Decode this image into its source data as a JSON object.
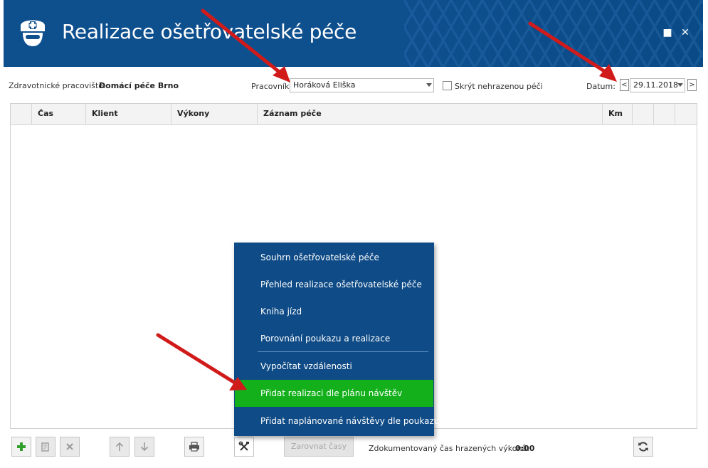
{
  "window": {
    "title": "Realizace ošetřovatelské péče",
    "controls": {
      "maximize_icon": "■",
      "close_icon": "✕"
    }
  },
  "toolbar": {
    "workplace_label": "Zdravotnické pracoviště:",
    "workplace_value": "Domácí péče Brno",
    "worker_label": "Pracovník:",
    "worker_value": "Horáková Eliška",
    "hide_unpaid_label": "Skrýt nehrazenou péči",
    "hide_unpaid_checked": false,
    "date_label": "Datum:",
    "date_value": "29.11.2018",
    "prev_label": "<",
    "next_label": ">"
  },
  "grid": {
    "columns": [
      "",
      "Čas",
      "Klient",
      "Výkony",
      "Záznam péče",
      "Km",
      "",
      "",
      ""
    ],
    "rows": []
  },
  "context_menu": {
    "items": [
      {
        "label": "Souhrn ošetřovatelské péče",
        "highlighted": false
      },
      {
        "label": "Přehled realizace ošetřovatelské péče",
        "highlighted": false
      },
      {
        "label": "Kniha jízd",
        "highlighted": false
      },
      {
        "label": "Porovnání poukazu a realizace",
        "highlighted": false
      },
      {
        "label": "Vypočítat vzdálenosti",
        "highlighted": false
      },
      {
        "label": "Přidat realizaci dle plánu návštěv",
        "highlighted": true
      },
      {
        "label": "Přidat naplánované návštěvy dle poukazu",
        "highlighted": false
      }
    ],
    "highlight_color": "#13b01b",
    "background_color": "#0f4b86"
  },
  "bottom_bar": {
    "align_times_label": "Zarovnat časy",
    "documented_time_label": "Zdokumentovaný čas hrazených výkonů:",
    "documented_time_value": "0:00",
    "icons": [
      "add-icon",
      "edit-icon",
      "delete-icon",
      "move-up-icon",
      "move-down-icon",
      "print-icon",
      "tools-icon",
      "refresh-icon"
    ]
  },
  "colors": {
    "titlebar": "#0e4f8e",
    "add_icon": "#2fa02a",
    "annotation_arrow": "#d11a1a"
  }
}
